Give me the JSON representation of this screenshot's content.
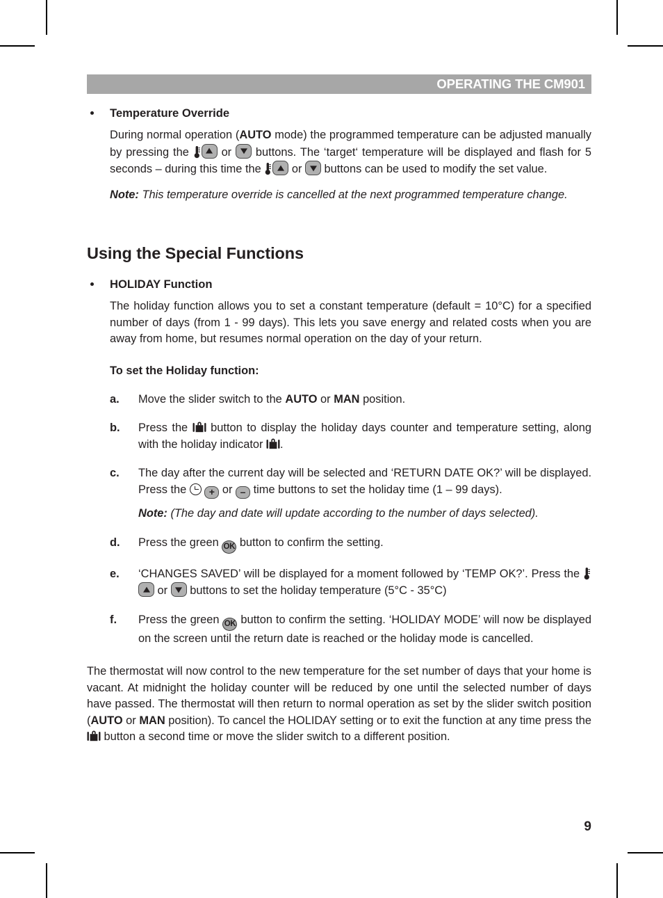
{
  "header": {
    "title": "OPERATING THE CM901",
    "bar_color": "#a7a7a7",
    "text_color": "#ffffff"
  },
  "page_number": "9",
  "section1": {
    "bullet_title": "Temperature Override",
    "para1_a": "During normal operation (",
    "para1_auto": "AUTO",
    "para1_b": " mode) the programmed temperature can be adjusted manually by pressing the ",
    "para1_c": " or ",
    "para1_d": " buttons. The ‘target‘ temperature will be displayed and flash for 5 seconds – during this time the ",
    "para1_e": " or ",
    "para1_f": " buttons can be used to modify the set value.",
    "note_label": "Note:",
    "note_text": " This temperature override is cancelled at the next programmed temperature change."
  },
  "section2": {
    "heading": "Using the Special Functions",
    "bullet_title": "HOLIDAY Function",
    "intro": "The holiday function allows you to set a constant temperature (default = 10°C) for a specified number of days (from 1 - 99 days). This lets you save energy and related costs when you are away from home, but resumes normal operation on the day of your return.",
    "subheading": "To set the Holiday function:",
    "steps": [
      {
        "marker": "a.",
        "text_a": "Move the slider switch to the ",
        "bold_1": "AUTO",
        "text_b": " or ",
        "bold_2": "MAN",
        "text_c": " position."
      },
      {
        "marker": "b.",
        "text_a": "Press the ",
        "text_b": " button to display the holiday days counter and temperature setting, along with the holiday indicator ",
        "text_c": "."
      },
      {
        "marker": "c.",
        "text_a": "The day after the current day will be selected and ‘RETURN DATE OK?’ will be displayed. Press the ",
        "text_b": " ",
        "text_c": " or ",
        "text_d": " time buttons to set the holiday time (1 – 99 days).",
        "note_label": "Note:",
        "note_text": " (The day and date will update according to the number of days selected)."
      },
      {
        "marker": "d.",
        "text_a": "Press the green ",
        "text_b": " button to confirm the setting."
      },
      {
        "marker": "e.",
        "text_a": "‘CHANGES SAVED’ will be displayed for a moment followed by ‘TEMP OK?’. Press the ",
        "text_b": " or ",
        "text_c": " buttons to set the holiday temperature (5°C - 35°C)"
      },
      {
        "marker": "f.",
        "text_a": "Press the green ",
        "text_b": " button to confirm the setting. ‘HOLIDAY MODE’ will now be displayed on the screen until the return date is reached or the holiday mode is cancelled."
      }
    ],
    "closing": {
      "text_a": "The thermostat will now control to the new temperature for the set number of days that your home is vacant. At midnight the holiday counter will be reduced by one until the selected number of days have passed. The thermostat will then return to normal operation as set by the slider switch position (",
      "bold_1": "AUTO",
      "text_b": " or ",
      "bold_2": "MAN",
      "text_c": " position). To cancel the HOLIDAY setting or to exit the function at any time press the ",
      "text_d": " button a second time or move the slider switch to a different position."
    }
  },
  "icons": {
    "thermometer": "thermometer-icon",
    "up_button": "up-arrow-button-icon",
    "down_button": "down-arrow-button-icon",
    "clock": "clock-icon",
    "plus_button": "+",
    "minus_button": "–",
    "ok_button": "OK",
    "holiday": "briefcase-holiday-icon"
  }
}
